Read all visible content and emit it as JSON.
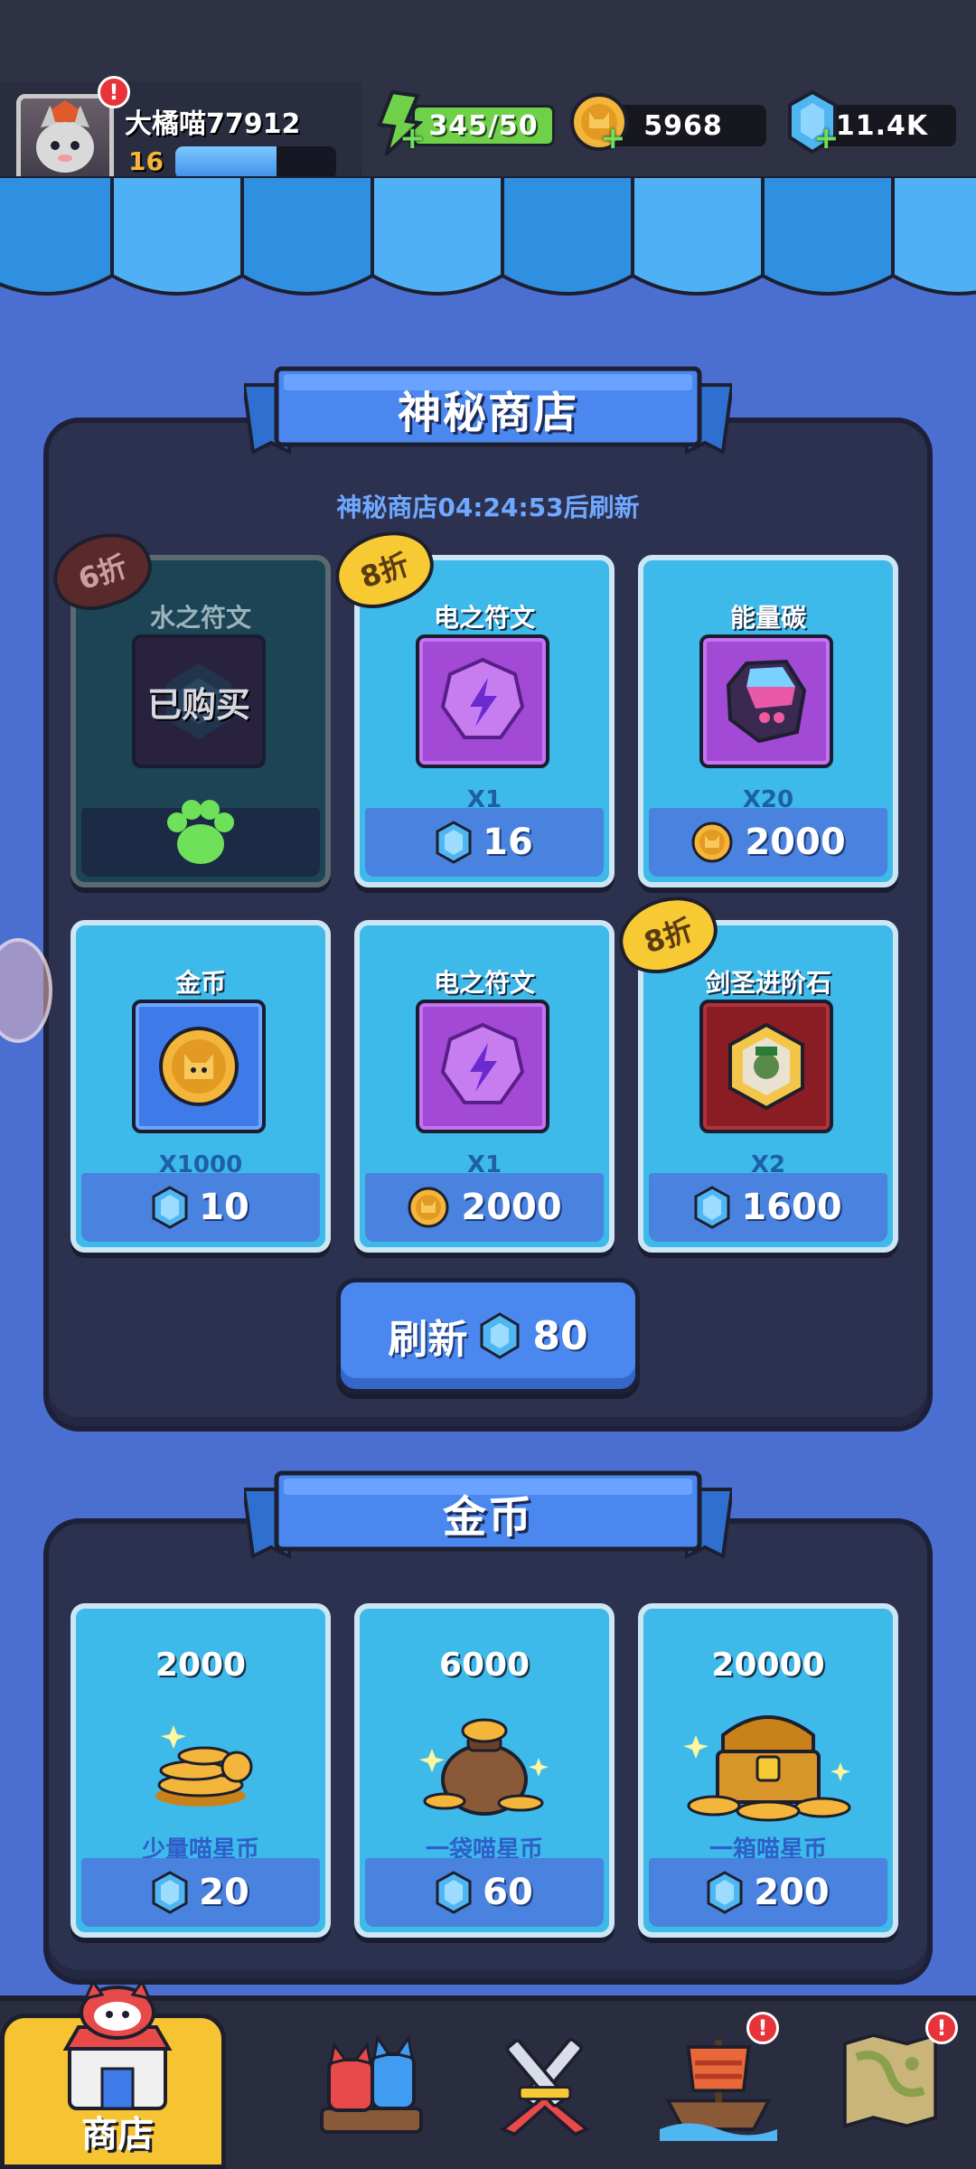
{
  "player": {
    "name": "大橘喵77912",
    "level": "16",
    "xp_fraction": 0.63,
    "alert": "!"
  },
  "resources": {
    "energy": "345/50",
    "coins": "5968",
    "gems": "11.4K"
  },
  "mystery_shop": {
    "title": "神秘商店",
    "refresh_timer": "神秘商店04:24:53后刷新",
    "items": [
      {
        "title": "水之符文",
        "discount": "6折",
        "sold": true,
        "sold_label": "已购买",
        "icon": "water-rune-icon",
        "qty": "",
        "price": "",
        "currency": ""
      },
      {
        "title": "电之符文",
        "discount": "8折",
        "sold": false,
        "icon": "lightning-rune-icon",
        "qty": "X1",
        "price": "16",
        "currency": "gem"
      },
      {
        "title": "能量碳",
        "discount": "",
        "sold": false,
        "icon": "energy-carbon-icon",
        "qty": "X20",
        "price": "2000",
        "currency": "coin"
      },
      {
        "title": "金币",
        "discount": "",
        "sold": false,
        "icon": "coin-icon",
        "qty": "X1000",
        "price": "10",
        "currency": "gem"
      },
      {
        "title": "电之符文",
        "discount": "",
        "sold": false,
        "icon": "lightning-rune-icon",
        "qty": "X1",
        "price": "2000",
        "currency": "coin"
      },
      {
        "title": "剑圣进阶石",
        "discount": "8折",
        "sold": false,
        "icon": "swordmaster-stone-icon",
        "qty": "X2",
        "price": "1600",
        "currency": "gem"
      }
    ],
    "refresh_button": {
      "label": "刷新",
      "cost": "80"
    }
  },
  "coin_shop": {
    "title": "金币",
    "packs": [
      {
        "amount": "2000",
        "label": "少量喵星币",
        "price": "20",
        "icon": "coin-pile-icon"
      },
      {
        "amount": "6000",
        "label": "一袋喵星币",
        "price": "60",
        "icon": "coin-bag-icon"
      },
      {
        "amount": "20000",
        "label": "一箱喵星币",
        "price": "200",
        "icon": "treasure-chest-icon"
      }
    ]
  },
  "bottom_nav": {
    "items": [
      {
        "label": "商店",
        "icon": "shop-icon",
        "active": true
      },
      {
        "label": "",
        "icon": "cats-team-icon",
        "alert": false
      },
      {
        "label": "",
        "icon": "battle-swords-icon",
        "alert": false
      },
      {
        "label": "",
        "icon": "pirate-ship-icon",
        "alert": true
      },
      {
        "label": "",
        "icon": "map-icon",
        "alert": true
      }
    ]
  },
  "colors": {
    "background": "#4a6fd1",
    "panel": "#2d3150",
    "card": "#3dbaea",
    "price_bar": "#4a82e0",
    "accent_gold": "#f7c933"
  }
}
